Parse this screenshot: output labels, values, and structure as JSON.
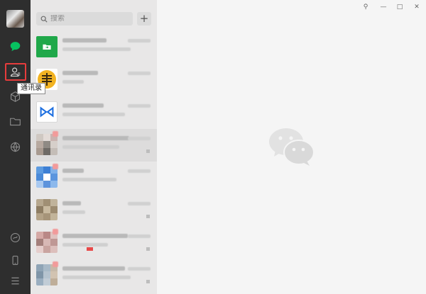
{
  "sidebar": {
    "tooltip": "通讯录",
    "icons": [
      "chat-icon",
      "contacts-icon",
      "cube-icon",
      "folder-icon",
      "moments-icon",
      "mini-program-icon",
      "phone-icon",
      "menu-icon"
    ],
    "accent": "#07c160"
  },
  "search": {
    "placeholder": "搜索",
    "add_label": "+"
  },
  "window_controls": {
    "pin": "⚲",
    "minimize": "—",
    "maximize": "□",
    "close": "✕"
  },
  "chats": [
    {
      "avatar": "green-folder-icon"
    },
    {
      "avatar": "yellow-bank-logo"
    },
    {
      "avatar": "blue-logo"
    },
    {
      "avatar": "pixelated-photo"
    },
    {
      "avatar": "pixelated-blue"
    },
    {
      "avatar": "pixelated-photo"
    },
    {
      "avatar": "pixelated-photo"
    },
    {
      "avatar": "pixelated-photo"
    }
  ]
}
